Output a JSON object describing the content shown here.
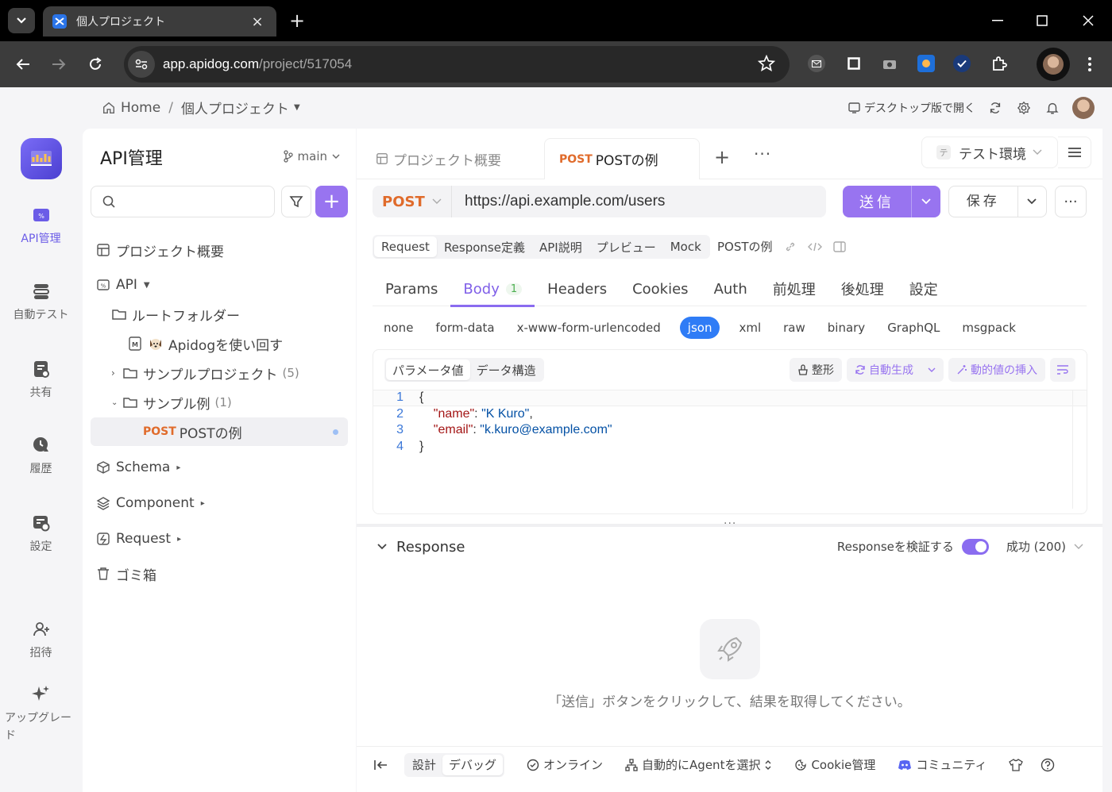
{
  "browser": {
    "tab_title": "個人プロジェクト",
    "url_host": "app.apidog.com",
    "url_path": "/project/517054"
  },
  "header": {
    "home": "Home",
    "project": "個人プロジェクト",
    "desktop_open": "デスクトップ版で開く"
  },
  "rail": {
    "items": [
      {
        "label": "API管理",
        "icon": "api-icon"
      },
      {
        "label": "自動テスト",
        "icon": "auto-test-icon"
      },
      {
        "label": "共有",
        "icon": "share-icon"
      },
      {
        "label": "履歴",
        "icon": "history-icon"
      },
      {
        "label": "設定",
        "icon": "settings-icon"
      },
      {
        "label": "招待",
        "icon": "invite-icon"
      },
      {
        "label": "アップグレード",
        "icon": "sparkle-icon"
      }
    ]
  },
  "sidebar": {
    "title": "API管理",
    "branch": "main",
    "search_placeholder": "",
    "items": [
      {
        "label": "プロジェクト概要"
      },
      {
        "label": "API"
      },
      {
        "label": "ルートフォルダー"
      },
      {
        "label": "Apidogを使い回す"
      },
      {
        "label": "サンプルプロジェクト",
        "count": "(5)"
      },
      {
        "label": "サンプル例",
        "count": "(1)"
      },
      {
        "method": "POST",
        "label": "POSTの例"
      },
      {
        "label": "Schema"
      },
      {
        "label": "Component"
      },
      {
        "label": "Request"
      },
      {
        "label": "ゴミ箱"
      }
    ]
  },
  "tabs": {
    "overview": "プロジェクト概要",
    "active_method": "POST",
    "active_label": "POSTの例",
    "env": "テスト環境",
    "env_badge": "テ"
  },
  "request": {
    "method": "POST",
    "url": "https://api.example.com/users",
    "send": "送信",
    "save": "保存",
    "sub_tabs": [
      "Request",
      "Response定義",
      "API説明",
      "プレビュー",
      "Mock"
    ],
    "name": "POSTの例",
    "tabs": [
      "Params",
      "Body",
      "Headers",
      "Cookies",
      "Auth",
      "前処理",
      "後処理",
      "設定"
    ],
    "body_badge": "1",
    "body_types": [
      "none",
      "form-data",
      "x-www-form-urlencoded",
      "json",
      "xml",
      "raw",
      "binary",
      "GraphQL",
      "msgpack"
    ],
    "editor_modes": [
      "パラメータ値",
      "データ構造"
    ],
    "tools": {
      "format": "整形",
      "autogen": "自動生成",
      "insert": "動的値の挿入"
    },
    "code": {
      "line_numbers": [
        "1",
        "2",
        "3",
        "4"
      ],
      "open": "{",
      "key1": "\"name\"",
      "val1": "\"K Kuro\"",
      "key2": "\"email\"",
      "val2": "\"k.kuro@example.com\"",
      "close": "}"
    }
  },
  "response": {
    "title": "Response",
    "validate": "Responseを検証する",
    "status": "成功 (200)",
    "empty": "「送信」ボタンをクリックして、結果を取得してください。"
  },
  "statusbar": {
    "modes": [
      "設計",
      "デバッグ"
    ],
    "online": "オンライン",
    "agent": "自動的にAgentを選択",
    "cookie": "Cookie管理",
    "community": "コミュニティ"
  },
  "colors": {
    "accent": "#9874f0",
    "post": "#e06b2b",
    "json_active": "#2f7cf6"
  }
}
